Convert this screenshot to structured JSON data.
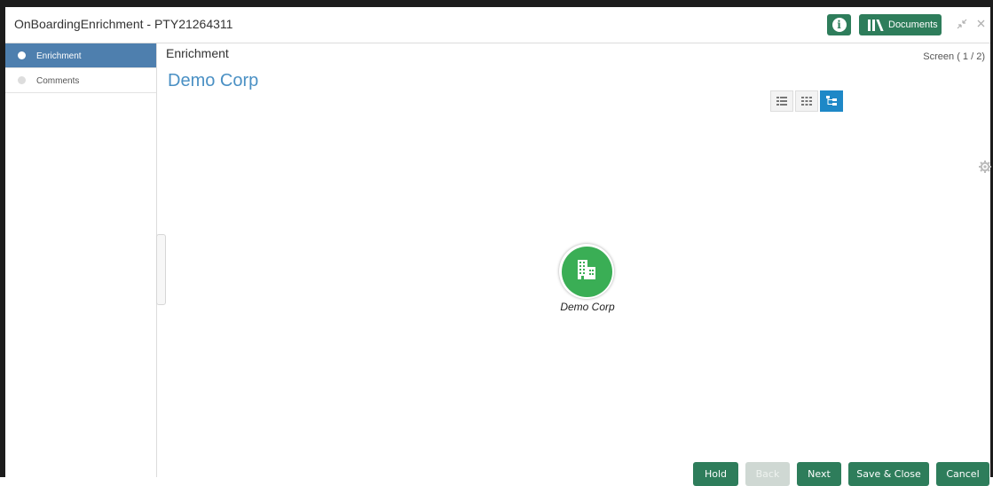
{
  "window": {
    "title": "OnBoardingEnrichment - PTY21264311",
    "info_icon": "info-icon",
    "documents_label": "Documents",
    "documents_icon": "library-icon",
    "minimize_icon": "collapse-arrows-icon",
    "close_icon": "close-icon"
  },
  "sidebar": {
    "items": [
      {
        "label": "Enrichment",
        "active": true
      },
      {
        "label": "Comments",
        "active": false
      }
    ]
  },
  "main": {
    "section_title": "Enrichment",
    "screen_counter": "Screen ( 1 / 2)",
    "entity_name": "Demo Corp",
    "view_modes": [
      "list-view-icon",
      "grid-view-icon",
      "tree-view-icon"
    ],
    "active_view": "tree-view-icon",
    "settings_icon": "gear-icon"
  },
  "hierarchy": {
    "node_label": "Demo Corp",
    "node_icon": "building-icon",
    "node_color": "#3aae55"
  },
  "footer": {
    "hold": "Hold",
    "back": "Back",
    "next": "Next",
    "save_close": "Save & Close",
    "cancel": "Cancel"
  },
  "colors": {
    "primary": "#2e7d5b",
    "sidebar_active": "#4e7fae",
    "accent_blue": "#1e88c7",
    "entity_title": "#4a90c4"
  }
}
